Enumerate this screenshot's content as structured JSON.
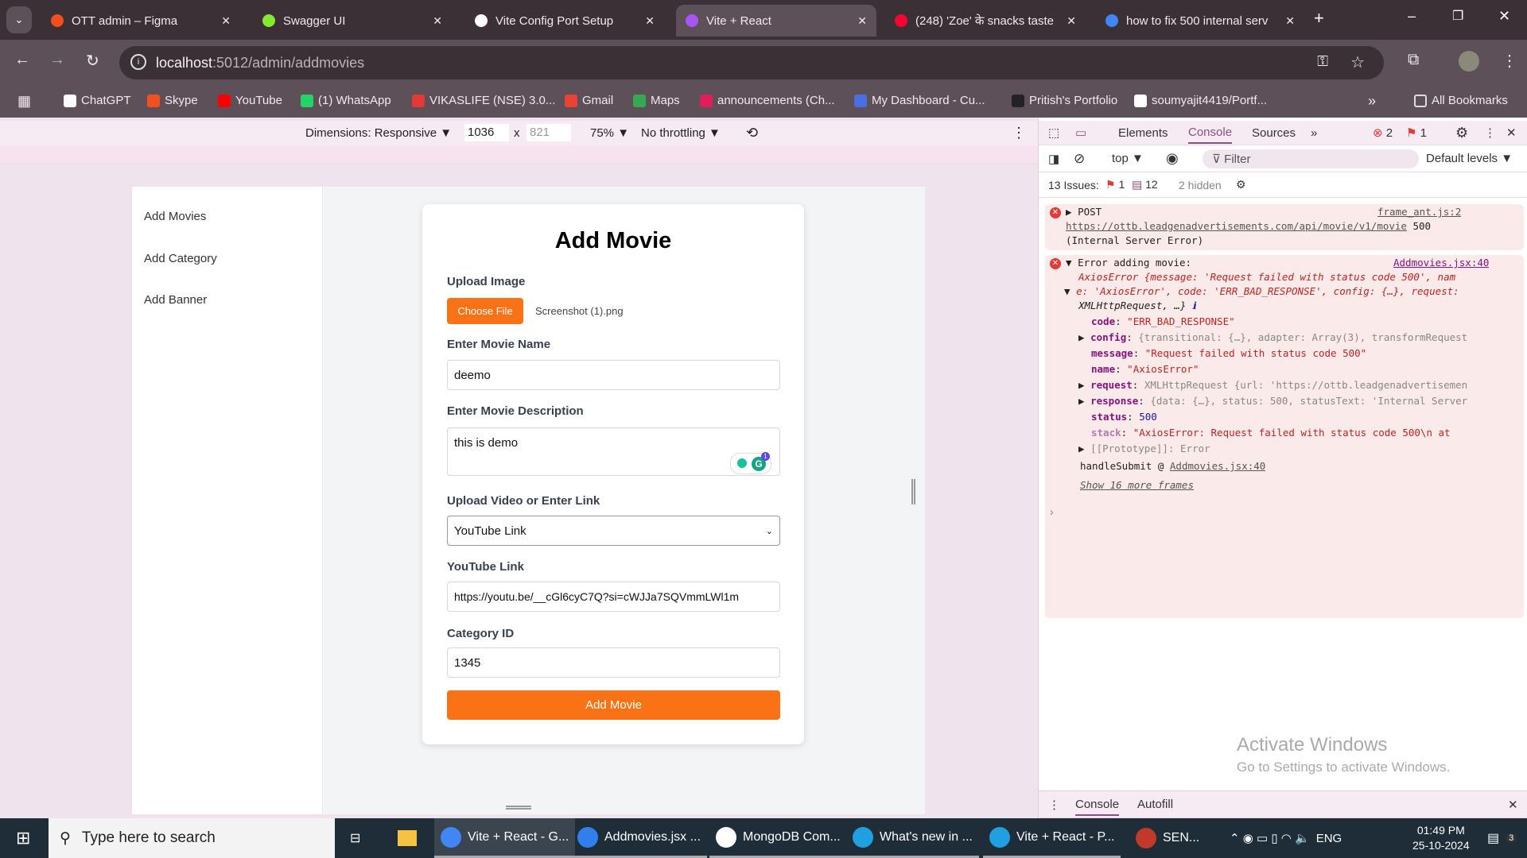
{
  "browser": {
    "tabs": [
      {
        "title": "OTT admin – Figma",
        "color": "#f24e1e"
      },
      {
        "title": "Swagger UI",
        "color": "#85ea2d"
      },
      {
        "title": "Vite Config Port Setup",
        "color": "#ffffff"
      },
      {
        "title": "Vite + React",
        "color": "#a855f7",
        "active": true
      },
      {
        "title": "(248) 'Zoe' के snacks taste",
        "color": "#ff0033"
      },
      {
        "title": "how to fix 500 internal serv",
        "color": "#4285f4"
      }
    ],
    "close_glyph": "✕",
    "new_tab": "+",
    "url_host": "localhost",
    "url_path": ":5012/admin/addmovies",
    "bookmarks": [
      "ChatGPT",
      "Skype",
      "YouTube",
      "(1) WhatsApp",
      "VIKASLIFE (NSE) 3.0...",
      "Gmail",
      "Maps",
      "announcements (Ch...",
      "My Dashboard - Cu...",
      "Pritish's Portfolio",
      "soumyajit4419/Portf..."
    ],
    "bookmark_colors": [
      "#ffffff",
      "#f25022",
      "#ff0000",
      "#25d366",
      "#e53935",
      "#ea4335",
      "#34a853",
      "#e01e5a",
      "#4a6fe3",
      "#222222",
      "#ffffff"
    ],
    "all_bookmarks": "All Bookmarks"
  },
  "device_toolbar": {
    "dimensions": "Dimensions: Responsive ▼",
    "width": "1036",
    "x": "x",
    "height": "821",
    "zoom": "75% ▼",
    "throttling": "No throttling ▼"
  },
  "app": {
    "sidebar": [
      "Add Movies",
      "Add Category",
      "Add Banner"
    ],
    "form": {
      "title": "Add Movie",
      "upload_label": "Upload Image",
      "choose_file": "Choose File",
      "file_name": "Screenshot (1).png",
      "name_label": "Enter Movie Name",
      "name_value": "deemo",
      "desc_label": "Enter Movie Description",
      "desc_value": "this is demo",
      "video_label": "Upload Video or Enter Link",
      "video_select": "YouTube Link",
      "yt_label": "YouTube Link",
      "yt_value": "https://youtu.be/__cGl6cyC7Q?si=cWJJa7SQVmmLWl1m",
      "cat_label": "Category ID",
      "cat_value": "1345",
      "submit": "Add Movie",
      "accent": "#f97316",
      "grammarly_badge": "1"
    }
  },
  "devtools": {
    "tabs": [
      "Elements",
      "Console",
      "Sources",
      "»"
    ],
    "active_tab": "Console",
    "error_count": "2",
    "issue_count": "1",
    "context": "top ▼",
    "filter_placeholder": "Filter",
    "levels": "Default levels ▼",
    "issues_label": "13 Issues:",
    "issues_err": "1",
    "issues_info": "12",
    "hidden": "2 hidden",
    "log1": {
      "method": "POST",
      "source": "frame_ant.js:2",
      "url": "https://ottb.leadgenadvertisements.com/api/movie/v1/movie",
      "status": "500",
      "status_text": "(Internal Server Error)"
    },
    "log2": {
      "title": "Error adding movie:",
      "source": "Addmovies.jsx:40",
      "l1": "AxiosError {message: 'Request failed with status code 500', nam",
      "l2": "e: 'AxiosError', code: 'ERR_BAD_RESPONSE', config: {…}, request:",
      "l3": "XMLHttpRequest, …}",
      "code": "\"ERR_BAD_RESPONSE\"",
      "config": "{transitional: {…}, adapter: Array(3), transformRequest",
      "message": "\"Request failed with status code 500\"",
      "name": "\"AxiosError\"",
      "request": "XMLHttpRequest {url: 'https://ottb.leadgenadvertisemen",
      "response": "{data: {…}, status: 500, statusText: 'Internal Server",
      "status": "500",
      "stack": "\"AxiosError: Request failed with status code 500\\n    at",
      "proto": "[[Prototype]]: Error",
      "handler": "handleSubmit @ ",
      "handler_src": "Addmovies.jsx:40",
      "more": "Show 16 more frames"
    },
    "drawer": [
      "Console",
      "Autofill"
    ],
    "watermark_title": "Activate Windows",
    "watermark_sub": "Go to Settings to activate Windows."
  },
  "taskbar": {
    "search": "Type here to search",
    "apps": [
      "Vite + React - G...",
      "Addmovies.jsx ...",
      "MongoDB Com...",
      "What's new in ...",
      "Vite + React - P...",
      "SEN..."
    ],
    "lang": "ENG",
    "time": "01:49 PM",
    "date": "25-10-2024",
    "notif": "3"
  }
}
